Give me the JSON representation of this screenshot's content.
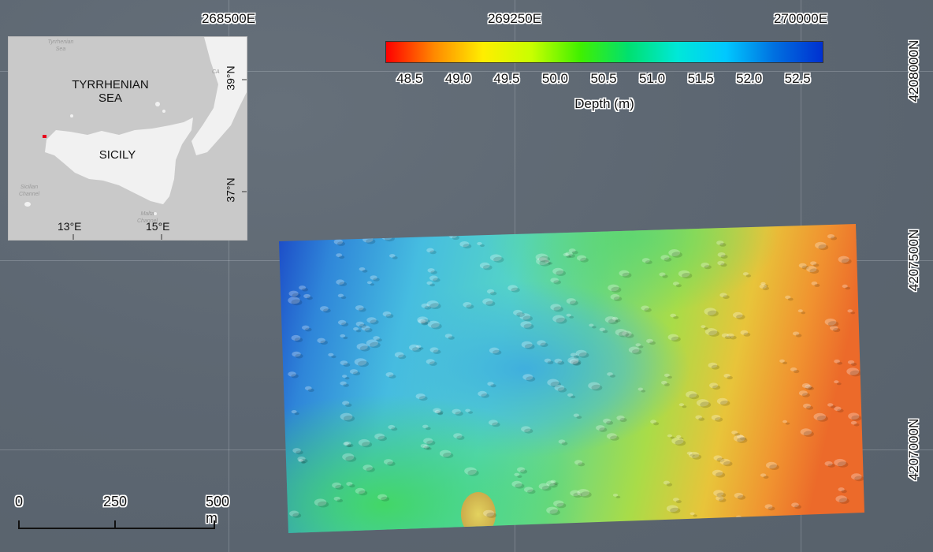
{
  "map": {
    "easting_labels": [
      "268500E",
      "269250E",
      "270000E"
    ],
    "northing_labels": [
      "4208000N",
      "4207500N",
      "4207000N"
    ]
  },
  "legend": {
    "title": "Depth (m)",
    "ticks": [
      "48.5",
      "49.0",
      "49.5",
      "50.0",
      "50.5",
      "51.0",
      "51.5",
      "52.0",
      "52.5"
    ],
    "min": 48.25,
    "max": 52.75,
    "colors": [
      "#ff0000",
      "#ff8a00",
      "#ffee00",
      "#c8ff00",
      "#40f000",
      "#00e070",
      "#00e8d8",
      "#00c8ff",
      "#0070e0",
      "#0030d0"
    ]
  },
  "inset": {
    "sea_label_line1": "TYRRHENIAN",
    "sea_label_line2": "SEA",
    "island_label": "SICILY",
    "tyrrhenian_small_line1": "Tyrrhenian",
    "tyrrhenian_small_line2": "Sea",
    "sicilian_channel_line1": "Sicilian",
    "sicilian_channel_line2": "Channel",
    "malta_channel_line1": "Malta",
    "malta_channel_line2": "Channel",
    "calabria_small": "CA",
    "lon_ticks": [
      "13°E",
      "15°E"
    ],
    "lat_ticks": [
      "39°N",
      "37°N"
    ],
    "marker_color": "#e8001c"
  },
  "scalebar": {
    "labels": [
      "0",
      "250",
      "500 m"
    ]
  }
}
